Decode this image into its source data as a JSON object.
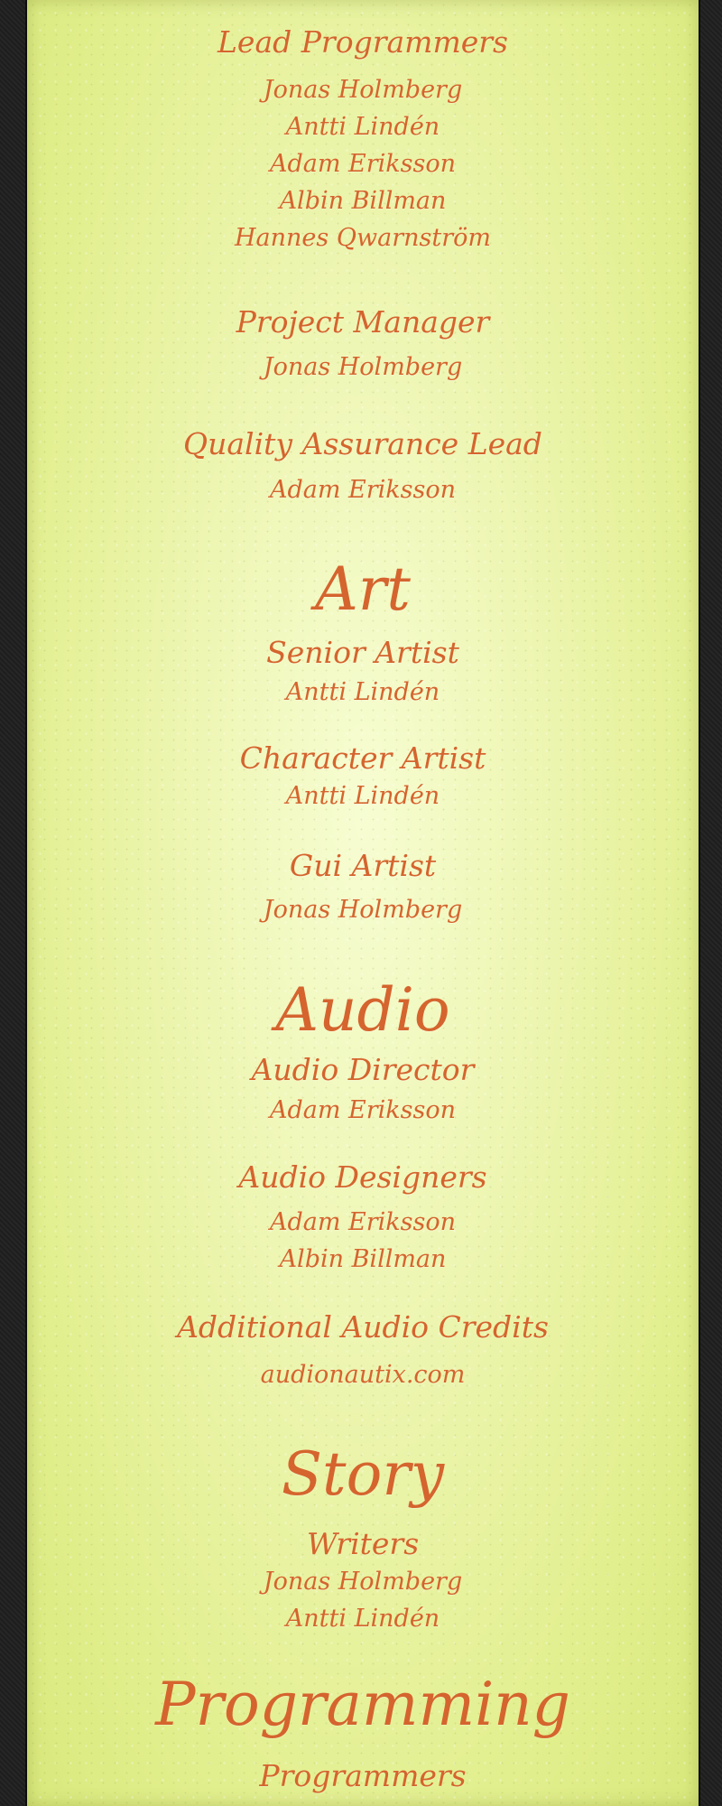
{
  "colors": {
    "text": "#d5642e",
    "parchment": "#eef6b4",
    "border": "#1f1f1f"
  },
  "credits": {
    "lead_programmers": {
      "title": "Lead Programmers",
      "names": [
        "Jonas Holmberg",
        "Antti Lindén",
        "Adam Eriksson",
        "Albin Billman",
        "Hannes Qwarnström"
      ]
    },
    "project_manager": {
      "title": "Project Manager",
      "names": [
        "Jonas Holmberg"
      ]
    },
    "qa_lead": {
      "title": "Quality Assurance Lead",
      "names": [
        "Adam Eriksson"
      ]
    },
    "art": {
      "heading": "Art",
      "senior_artist": {
        "title": "Senior Artist",
        "names": [
          "Antti Lindén"
        ]
      },
      "character_artist": {
        "title": "Character Artist",
        "names": [
          "Antti Lindén"
        ]
      },
      "gui_artist": {
        "title": "Gui Artist",
        "names": [
          "Jonas Holmberg"
        ]
      }
    },
    "audio": {
      "heading": "Audio",
      "audio_director": {
        "title": "Audio Director",
        "names": [
          "Adam Eriksson"
        ]
      },
      "audio_designers": {
        "title": "Audio Designers",
        "names": [
          "Adam Eriksson",
          "Albin Billman"
        ]
      },
      "additional_audio": {
        "title": "Additional Audio Credits",
        "names": [
          "audionautix.com"
        ]
      }
    },
    "story": {
      "heading": "Story",
      "writers": {
        "title": "Writers",
        "names": [
          "Jonas Holmberg",
          "Antti Lindén"
        ]
      }
    },
    "programming": {
      "heading": "Programming",
      "programmers": {
        "title": "Programmers"
      }
    }
  }
}
